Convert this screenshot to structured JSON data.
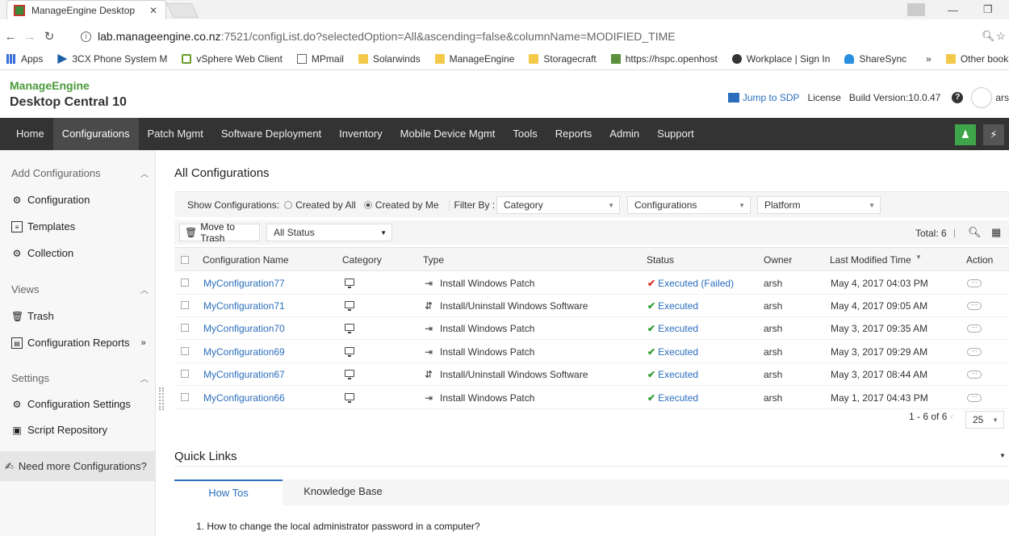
{
  "browser": {
    "tab_title": "ManageEngine Desktop",
    "url_host": "lab.manageengine.co.nz",
    "url_rest": ":7521/configList.do?selectedOption=All&ascending=false&columnName=MODIFIED_TIME",
    "bookmarks": [
      "Apps",
      "3CX Phone System M",
      "vSphere Web Client",
      "MPmail",
      "Solarwinds",
      "ManageEngine",
      "Storagecraft",
      "https://hspc.openhost",
      "Workplace | Sign In",
      "ShareSync",
      "»",
      "Other book"
    ]
  },
  "header": {
    "logo_brand": "ManageEngine",
    "product": "Desktop Central 10",
    "jump": "Jump to SDP",
    "license": "License",
    "build": "Build Version:10.0.47",
    "help": "?",
    "user": "ars"
  },
  "nav": {
    "items": [
      "Home",
      "Configurations",
      "Patch Mgmt",
      "Software Deployment",
      "Inventory",
      "Mobile Device Mgmt",
      "Tools",
      "Reports",
      "Admin",
      "Support"
    ],
    "active": "Configurations"
  },
  "sidebar": {
    "group1": "Add Configurations",
    "configuration": "Configuration",
    "templates": "Templates",
    "collection": "Collection",
    "group2": "Views",
    "trash": "Trash",
    "reports": "Configuration Reports",
    "reports_more": "»",
    "group3": "Settings",
    "settings": "Configuration Settings",
    "scripts": "Script Repository",
    "need_more": "Need more Configurations?"
  },
  "main": {
    "title": "All Configurations",
    "show_label": "Show Configurations:",
    "created_all": "Created by All",
    "created_me": "Created by Me",
    "filter_by": "Filter By :",
    "category": "Category",
    "configurations": "Configurations",
    "platform": "Platform",
    "move_trash": "Move to Trash",
    "all_status": "All Status",
    "total": "Total: 6",
    "columns": [
      "Configuration Name",
      "Category",
      "Type",
      "Status",
      "Owner",
      "Last Modified Time",
      "Action"
    ],
    "rows": [
      {
        "name": "MyConfiguration77",
        "type": "Install Windows Patch",
        "status": "Executed (Failed)",
        "owner": "arsh",
        "time": "May 4, 2017 04:03 PM"
      },
      {
        "name": "MyConfiguration71",
        "type": "Install/Uninstall Windows Software",
        "status": "Executed",
        "owner": "arsh",
        "time": "May 4, 2017 09:05 AM"
      },
      {
        "name": "MyConfiguration70",
        "type": "Install Windows Patch",
        "status": "Executed",
        "owner": "arsh",
        "time": "May 3, 2017 09:35 AM"
      },
      {
        "name": "MyConfiguration69",
        "type": "Install Windows Patch",
        "status": "Executed",
        "owner": "arsh",
        "time": "May 3, 2017 09:29 AM"
      },
      {
        "name": "MyConfiguration67",
        "type": "Install/Uninstall Windows Software",
        "status": "Executed",
        "owner": "arsh",
        "time": "May 3, 2017 08:44 AM"
      },
      {
        "name": "MyConfiguration66",
        "type": "Install Windows Patch",
        "status": "Executed",
        "owner": "arsh",
        "time": "May 1, 2017 04:43 PM"
      }
    ],
    "range": "1 - 6 of 6",
    "page_size": "25"
  },
  "quick_links": {
    "title": "Quick Links",
    "tab1": "How Tos",
    "tab2": "Knowledge Base",
    "item1": "1. How to change the local administrator password in a computer?"
  },
  "colors": {
    "nav_bg": "#333333",
    "link": "#2a6ebd",
    "ok": "#2e9c2e",
    "fail": "#d9352b"
  }
}
